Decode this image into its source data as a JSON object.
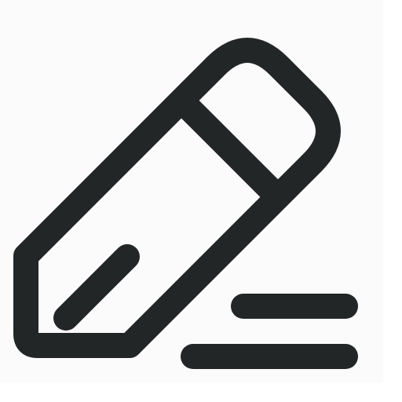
{
  "icon": {
    "name": "edit-pencil-icon",
    "stroke_color": "#232627",
    "background_color": "#fbfbfb"
  }
}
